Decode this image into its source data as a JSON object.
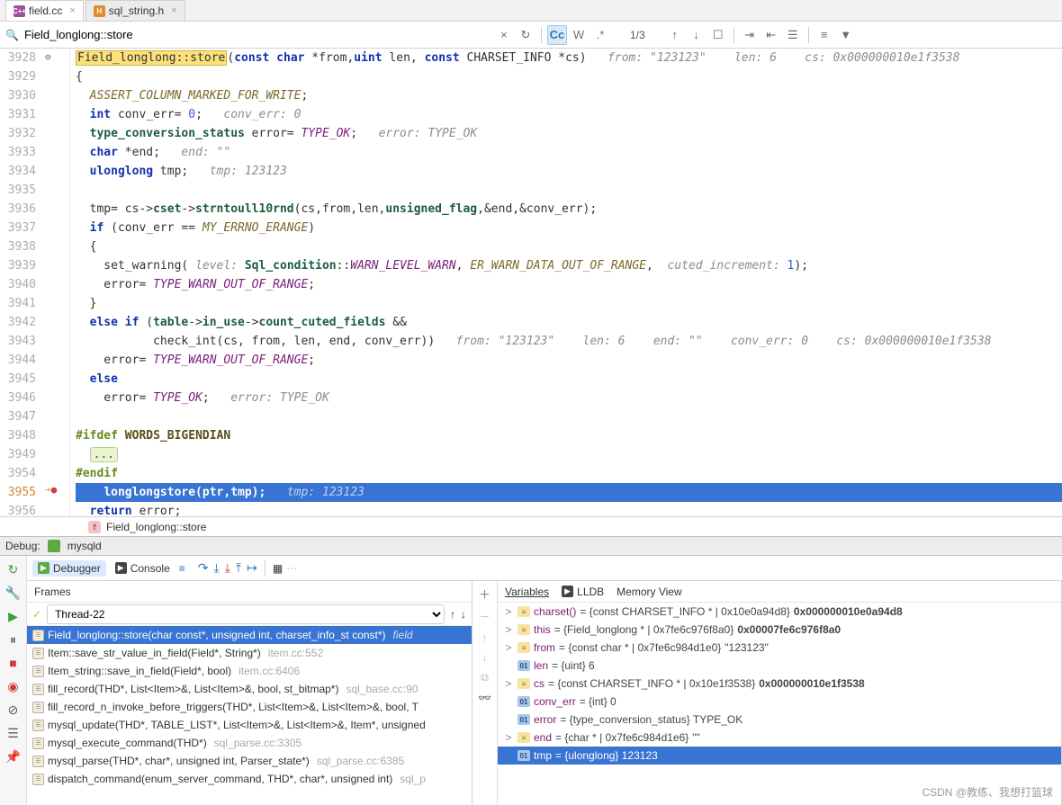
{
  "tabs": {
    "items": [
      {
        "label": "field.cc",
        "icon": "C++",
        "cls": "file-cpp",
        "active": true
      },
      {
        "label": "sql_string.h",
        "icon": "H",
        "cls": "file-h",
        "active": false
      }
    ]
  },
  "search": {
    "value": "Field_longlong::store",
    "counter": "1/3",
    "cc": "Cc",
    "w": "W",
    "regex": ".*"
  },
  "editor": {
    "scrollbar": true
  },
  "crumb": {
    "text": "Field_longlong::store"
  },
  "debug_hdr": {
    "label": "Debug:",
    "target": "mysqld"
  },
  "debug_toolbar": {
    "debugger": "Debugger",
    "console": "Console"
  },
  "frames_pane": {
    "title": "Frames",
    "thread": "Thread-22",
    "items": [
      {
        "sig": "Field_longlong::store(char const*, unsigned int, charset_info_st const*)",
        "loc": "field",
        "selected": true
      },
      {
        "sig": "Item::save_str_value_in_field(Field*, String*)",
        "loc": "item.cc:552"
      },
      {
        "sig": "Item_string::save_in_field(Field*, bool)",
        "loc": "item.cc:6406"
      },
      {
        "sig": "fill_record(THD*, List<Item>&, List<Item>&, bool, st_bitmap*)",
        "loc": "sql_base.cc:90"
      },
      {
        "sig": "fill_record_n_invoke_before_triggers(THD*, List<Item>&, List<Item>&, bool, T",
        "loc": ""
      },
      {
        "sig": "mysql_update(THD*, TABLE_LIST*, List<Item>&, List<Item>&, Item*, unsigned",
        "loc": ""
      },
      {
        "sig": "mysql_execute_command(THD*)",
        "loc": "sql_parse.cc:3305"
      },
      {
        "sig": "mysql_parse(THD*, char*, unsigned int, Parser_state*)",
        "loc": "sql_parse.cc:6385"
      },
      {
        "sig": "dispatch_command(enum_server_command, THD*, char*, unsigned int)",
        "loc": "sql_p"
      }
    ]
  },
  "vars_pane": {
    "tabs": {
      "variables": "Variables",
      "lldb": "LLDB",
      "memory": "Memory View"
    },
    "items": [
      {
        "exp": ">",
        "badge": "obj",
        "name": "charset()",
        "val": " = {const CHARSET_INFO * | 0x10e0a94d8} ",
        "hex": "0x000000010e0a94d8"
      },
      {
        "exp": ">",
        "badge": "obj",
        "name": "this",
        "val": " = {Field_longlong * | 0x7fe6c976f8a0} ",
        "hex": "0x00007fe6c976f8a0"
      },
      {
        "exp": ">",
        "badge": "obj",
        "name": "from",
        "val": " = {const char * | 0x7fe6c984d1e0} ",
        "hex": "\"123123\""
      },
      {
        "exp": "",
        "badge": "prim",
        "name": "len",
        "val": " = {uint} 6",
        "hex": ""
      },
      {
        "exp": ">",
        "badge": "obj",
        "name": "cs",
        "val": " = {const CHARSET_INFO * | 0x10e1f3538} ",
        "hex": "0x000000010e1f3538"
      },
      {
        "exp": "",
        "badge": "prim",
        "name": "conv_err",
        "val": " = {int} 0",
        "hex": ""
      },
      {
        "exp": "",
        "badge": "prim",
        "name": "error",
        "val": " = {type_conversion_status} TYPE_OK",
        "hex": ""
      },
      {
        "exp": ">",
        "badge": "obj",
        "name": "end",
        "val": " = {char * | 0x7fe6c984d1e6} ",
        "hex": "\"\""
      },
      {
        "exp": "",
        "badge": "prim",
        "name": "tmp",
        "val": " = {ulonglong} 123123",
        "hex": "",
        "selected": true
      }
    ]
  },
  "code": {
    "lines": [
      {
        "n": "3928",
        "mark": "gut-x"
      },
      {
        "n": "3929"
      },
      {
        "n": "3930"
      },
      {
        "n": "3931"
      },
      {
        "n": "3932"
      },
      {
        "n": "3933"
      },
      {
        "n": "3934"
      },
      {
        "n": "3935"
      },
      {
        "n": "3936"
      },
      {
        "n": "3937"
      },
      {
        "n": "3938"
      },
      {
        "n": "3939"
      },
      {
        "n": "3940"
      },
      {
        "n": "3941"
      },
      {
        "n": "3942"
      },
      {
        "n": "3943"
      },
      {
        "n": "3944"
      },
      {
        "n": "3945"
      },
      {
        "n": "3946"
      },
      {
        "n": "3947"
      },
      {
        "n": "3948"
      },
      {
        "n": "3949"
      },
      {
        "n": "3954"
      },
      {
        "n": "3955",
        "mark": "bp"
      },
      {
        "n": "3956"
      }
    ],
    "inlines": {
      "l0_from": "from: \"123123\"",
      "l0_len": "len: 6",
      "l0_cs": "cs: 0x000000010e1f3538",
      "l3_conv": "conv_err: 0",
      "l4_err": "error: TYPE_OK",
      "l5_end": "end: \"\"",
      "l6_tmp": "tmp: 123123",
      "l11_level": "level:",
      "l11_cut": "cuted_increment:",
      "l15_from": "from: \"123123\"",
      "l15_len": "len: 6",
      "l15_end": "end: \"\"",
      "l15_conv": "conv_err: 0",
      "l15_cs": "cs: 0x000000010e1f3538",
      "l18_err": "error: TYPE_OK",
      "l23_tmp": "tmp: 123123"
    }
  },
  "watermark": "CSDN @教练、我想打篮球"
}
